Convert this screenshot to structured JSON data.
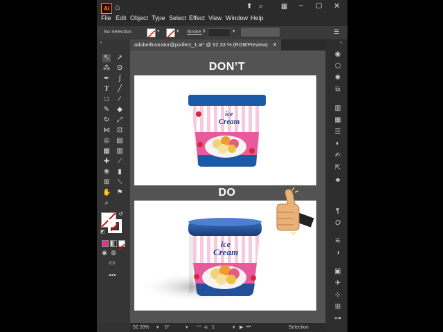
{
  "menu": {
    "logo": "Ai",
    "items": [
      "File",
      "Edit",
      "Object",
      "Type",
      "Select",
      "Effect",
      "View",
      "Window",
      "Help"
    ]
  },
  "control_bar": {
    "selection_label": "No Selection",
    "stroke_label": "Stroke:"
  },
  "document_tab": {
    "title": "adobeillustrator@pixifect_1.ai* @ 52.33 % (RGB/Preview)",
    "close": "✕"
  },
  "canvas": {
    "dont_label": "DON’T",
    "do_label": "DO",
    "product_text_line1": "ice",
    "product_text_line2": "Cream"
  },
  "status": {
    "zoom": "52.33%",
    "rotation": "0°",
    "artboard": "1",
    "tool": "Selection"
  },
  "colors": {
    "accent": "#ff9a00",
    "lid_flat": "#1b5aa6",
    "lid_real": "#22509a",
    "pink": "#e85a9c",
    "thumb": "#e8b27a"
  }
}
